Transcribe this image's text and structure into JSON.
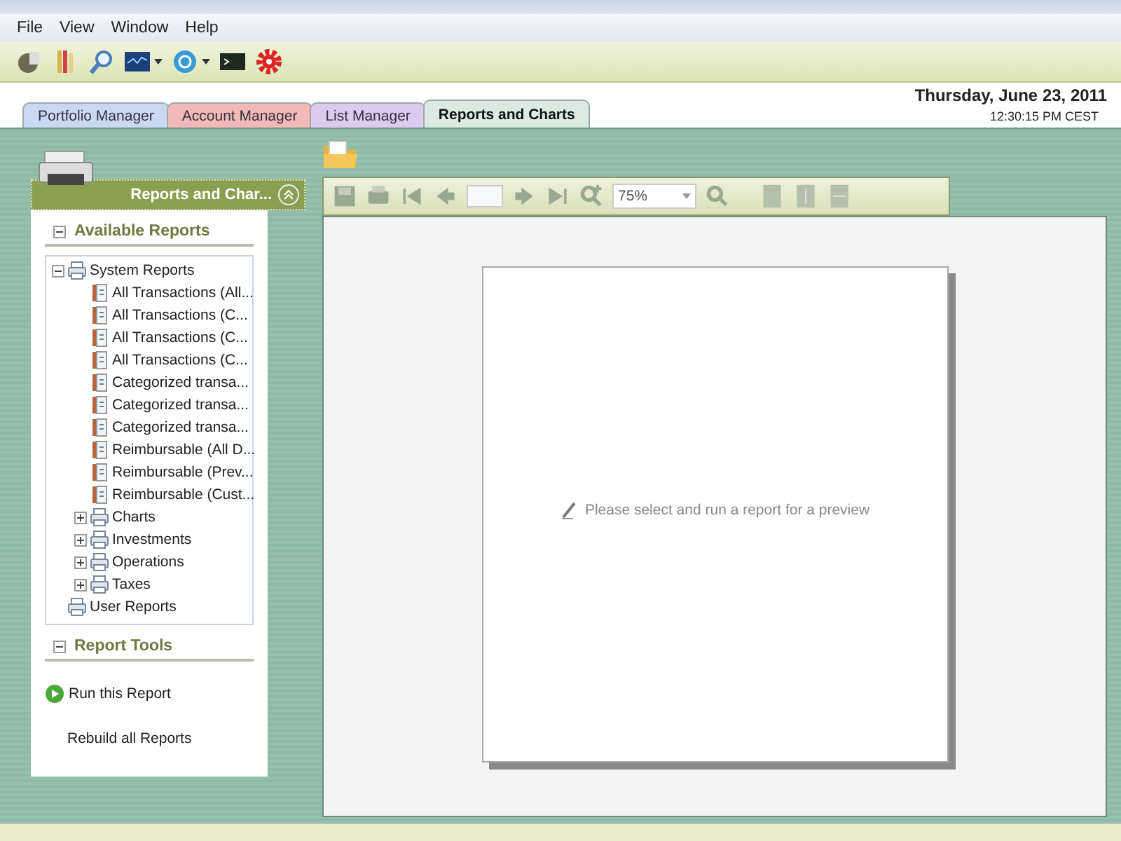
{
  "menu": [
    "File",
    "View",
    "Window",
    "Help"
  ],
  "tabs": [
    {
      "label": "Portfolio Manager",
      "selected": false,
      "color": "#c9d9f2"
    },
    {
      "label": "Account Manager",
      "selected": false,
      "color": "#f3b9b6"
    },
    {
      "label": "List Manager",
      "selected": false,
      "color": "#dccbee"
    },
    {
      "label": "Reports and Charts",
      "selected": true,
      "color": "#dde9e3"
    }
  ],
  "date": "Thursday, June 23, 2011",
  "time": "12:30:15 PM CEST",
  "sidebar": {
    "title": "Reports and Char...",
    "sections": [
      {
        "title": "Available Reports",
        "expanded": true,
        "tree": [
          {
            "label": "System Reports",
            "kind": "group",
            "expanded": true,
            "children": [
              {
                "label": "All Transactions (All...",
                "kind": "report"
              },
              {
                "label": "All Transactions (C...",
                "kind": "report"
              },
              {
                "label": "All Transactions (C...",
                "kind": "report"
              },
              {
                "label": "All Transactions (C...",
                "kind": "report"
              },
              {
                "label": "Categorized transa...",
                "kind": "report"
              },
              {
                "label": "Categorized transa...",
                "kind": "report"
              },
              {
                "label": "Categorized transa...",
                "kind": "report"
              },
              {
                "label": "Reimbursable (All D...",
                "kind": "report"
              },
              {
                "label": "Reimbursable (Prev...",
                "kind": "report"
              },
              {
                "label": "Reimbursable (Cust...",
                "kind": "report"
              },
              {
                "label": "Charts",
                "kind": "group",
                "expanded": false
              },
              {
                "label": "Investments",
                "kind": "group",
                "expanded": false
              },
              {
                "label": "Operations",
                "kind": "group",
                "expanded": false
              },
              {
                "label": "Taxes",
                "kind": "group",
                "expanded": false
              }
            ]
          },
          {
            "label": "User Reports",
            "kind": "group"
          }
        ]
      },
      {
        "title": "Report Tools",
        "expanded": true,
        "actions": [
          {
            "label": "Run this Report",
            "kind": "run"
          },
          {
            "label": "Rebuild all Reports",
            "kind": "plain"
          }
        ]
      }
    ]
  },
  "preview": {
    "zoom": "75%",
    "message": "Please select and run a report for a preview"
  }
}
